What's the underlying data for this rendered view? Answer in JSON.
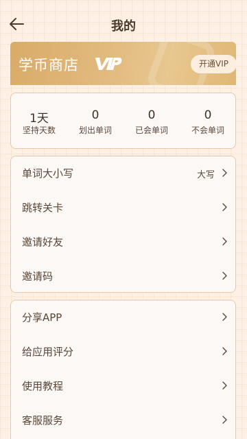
{
  "header": {
    "title": "我的",
    "back_icon": "arrow-left-icon"
  },
  "vip_banner": {
    "title": "学币商店",
    "badge_icon": "vip-badge-icon",
    "button_label": "开通VIP",
    "colors": {
      "gradient_start": "#d9ab67",
      "gradient_end": "#e8c790",
      "button_bg": "#fbeede"
    }
  },
  "stats": [
    {
      "value": "1天",
      "label": "坚持天数"
    },
    {
      "value": "0",
      "label": "划出单词"
    },
    {
      "value": "0",
      "label": "已会单词"
    },
    {
      "value": "0",
      "label": "不会单词"
    }
  ],
  "menu_group_1": [
    {
      "label": "单词大小写",
      "value": "大写"
    },
    {
      "label": "跳转关卡",
      "value": ""
    },
    {
      "label": "邀请好友",
      "value": ""
    },
    {
      "label": "邀请码",
      "value": ""
    }
  ],
  "menu_group_2": [
    {
      "label": "分享APP"
    },
    {
      "label": "给应用评分"
    },
    {
      "label": "使用教程"
    },
    {
      "label": "客服服务"
    }
  ],
  "chevron_icon": "chevron-right-icon"
}
